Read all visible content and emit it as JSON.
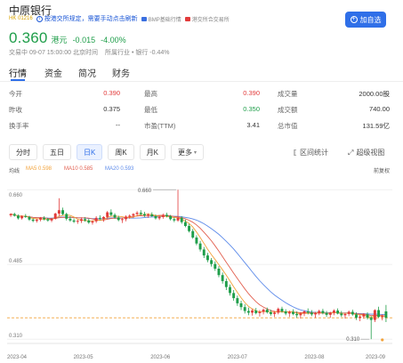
{
  "header": {
    "stock_name": "中原银行",
    "market_tag": "HK 01216",
    "notice": "按港交所规定，需要手动点击刷新",
    "notice_icon": "info-icon",
    "tag_bmp": "BMP基础行情",
    "tag_trade": "港交所合交易所",
    "watch_label": "加自选",
    "watch_icon": "plus-circle-icon"
  },
  "quote": {
    "price": "0.360",
    "currency": "港元",
    "change": "-0.015",
    "change_pct": "-4.00%",
    "status_time": "交易中 09-07 15:00:00 北京时间",
    "industry": "所属行业 • 银行 -0.44%",
    "down_color": "#1f9e4a",
    "up_color": "#e23b3b"
  },
  "tabs": [
    "行情",
    "资金",
    "简况",
    "财务"
  ],
  "stats": [
    [
      {
        "label": "今开",
        "value": "0.390",
        "color": "red"
      },
      {
        "label": "最高",
        "value": "0.390",
        "color": "red"
      },
      {
        "label": "成交量",
        "value": "2000.00股",
        "color": ""
      }
    ],
    [
      {
        "label": "昨收",
        "value": "0.375",
        "color": ""
      },
      {
        "label": "最低",
        "value": "0.350",
        "color": "green"
      },
      {
        "label": "成交额",
        "value": "740.00",
        "color": ""
      }
    ],
    [
      {
        "label": "换手率",
        "value": "--",
        "color": ""
      },
      {
        "label": "市盈(TTM)",
        "value": "3.41",
        "color": ""
      },
      {
        "label": "总市值",
        "value": "131.59亿",
        "color": ""
      }
    ]
  ],
  "periods": {
    "items": [
      "分时",
      "五日",
      "日K",
      "周K",
      "月K",
      "更多"
    ],
    "selected": "日K"
  },
  "tools": {
    "range_stats": "区间统计",
    "range_icon": "range-bracket-icon",
    "fullscreen": "超级视图",
    "fullscreen_icon": "expand-icon"
  },
  "legend": {
    "adjust": "均线",
    "ma5": "MA5 0.598",
    "ma10": "MA10 0.585",
    "ma20": "MA20 0.593",
    "right": "前复权",
    "ma5_color": "#f2a23a",
    "ma10_color": "#e25f4f",
    "ma20_color": "#5d8bea"
  },
  "chart_data": {
    "type": "candlestick",
    "y_ticks": [
      "0.660",
      "0.485",
      "0.310"
    ],
    "ylim": [
      0.3,
      0.675
    ],
    "x_ticks": [
      "2023-04",
      "2023-05",
      "2023-06",
      "2023-07",
      "2023-08",
      "2023-09"
    ],
    "annotations": [
      {
        "text": "0.660",
        "type": "max"
      },
      {
        "text": "0.310",
        "type": "min"
      }
    ],
    "last_price": 0.36,
    "candles": [
      [
        0.6,
        0.605,
        0.596,
        0.603
      ],
      [
        0.603,
        0.606,
        0.597,
        0.599
      ],
      [
        0.599,
        0.602,
        0.59,
        0.593
      ],
      [
        0.593,
        0.6,
        0.59,
        0.598
      ],
      [
        0.598,
        0.603,
        0.594,
        0.596
      ],
      [
        0.596,
        0.599,
        0.587,
        0.59
      ],
      [
        0.59,
        0.593,
        0.584,
        0.587
      ],
      [
        0.587,
        0.592,
        0.583,
        0.59
      ],
      [
        0.59,
        0.596,
        0.586,
        0.594
      ],
      [
        0.594,
        0.598,
        0.588,
        0.591
      ],
      [
        0.591,
        0.594,
        0.585,
        0.588
      ],
      [
        0.588,
        0.594,
        0.584,
        0.592
      ],
      [
        0.592,
        0.606,
        0.59,
        0.604
      ],
      [
        0.604,
        0.64,
        0.598,
        0.612
      ],
      [
        0.612,
        0.618,
        0.6,
        0.603
      ],
      [
        0.603,
        0.606,
        0.588,
        0.592
      ],
      [
        0.592,
        0.598,
        0.585,
        0.588
      ],
      [
        0.588,
        0.593,
        0.582,
        0.585
      ],
      [
        0.585,
        0.59,
        0.58,
        0.587
      ],
      [
        0.587,
        0.595,
        0.582,
        0.591
      ],
      [
        0.591,
        0.596,
        0.585,
        0.588
      ],
      [
        0.588,
        0.592,
        0.58,
        0.583
      ],
      [
        0.583,
        0.588,
        0.578,
        0.586
      ],
      [
        0.586,
        0.598,
        0.582,
        0.594
      ],
      [
        0.594,
        0.6,
        0.588,
        0.592
      ],
      [
        0.592,
        0.598,
        0.585,
        0.596
      ],
      [
        0.596,
        0.61,
        0.592,
        0.607
      ],
      [
        0.607,
        0.614,
        0.598,
        0.601
      ],
      [
        0.601,
        0.605,
        0.592,
        0.595
      ],
      [
        0.595,
        0.599,
        0.586,
        0.589
      ],
      [
        0.589,
        0.594,
        0.582,
        0.591
      ],
      [
        0.591,
        0.6,
        0.586,
        0.597
      ],
      [
        0.597,
        0.602,
        0.592,
        0.599
      ],
      [
        0.599,
        0.605,
        0.594,
        0.603
      ],
      [
        0.603,
        0.61,
        0.598,
        0.606
      ],
      [
        0.606,
        0.612,
        0.6,
        0.603
      ],
      [
        0.603,
        0.608,
        0.596,
        0.6
      ],
      [
        0.6,
        0.605,
        0.594,
        0.602
      ],
      [
        0.602,
        0.607,
        0.596,
        0.598
      ],
      [
        0.598,
        0.602,
        0.59,
        0.593
      ],
      [
        0.593,
        0.599,
        0.589,
        0.596
      ],
      [
        0.596,
        0.604,
        0.592,
        0.601
      ],
      [
        0.601,
        0.606,
        0.595,
        0.598
      ],
      [
        0.598,
        0.601,
        0.588,
        0.591
      ],
      [
        0.591,
        0.595,
        0.584,
        0.588
      ],
      [
        0.588,
        0.66,
        0.585,
        0.594
      ],
      [
        0.594,
        0.598,
        0.58,
        0.584
      ],
      [
        0.584,
        0.59,
        0.572,
        0.575
      ],
      [
        0.575,
        0.58,
        0.56,
        0.563
      ],
      [
        0.563,
        0.568,
        0.545,
        0.548
      ],
      [
        0.548,
        0.553,
        0.53,
        0.534
      ],
      [
        0.534,
        0.54,
        0.515,
        0.52
      ],
      [
        0.52,
        0.526,
        0.5,
        0.506
      ],
      [
        0.506,
        0.512,
        0.49,
        0.495
      ],
      [
        0.495,
        0.5,
        0.48,
        0.486
      ],
      [
        0.486,
        0.492,
        0.47,
        0.475
      ],
      [
        0.475,
        0.481,
        0.455,
        0.46
      ],
      [
        0.46,
        0.466,
        0.44,
        0.446
      ],
      [
        0.446,
        0.452,
        0.425,
        0.432
      ],
      [
        0.432,
        0.438,
        0.412,
        0.418
      ],
      [
        0.418,
        0.425,
        0.4,
        0.406
      ],
      [
        0.406,
        0.412,
        0.388,
        0.394
      ],
      [
        0.394,
        0.4,
        0.378,
        0.385
      ],
      [
        0.385,
        0.392,
        0.37,
        0.376
      ],
      [
        0.376,
        0.384,
        0.366,
        0.372
      ],
      [
        0.372,
        0.381,
        0.365,
        0.377
      ],
      [
        0.377,
        0.383,
        0.368,
        0.371
      ],
      [
        0.371,
        0.378,
        0.363,
        0.374
      ],
      [
        0.374,
        0.382,
        0.368,
        0.379
      ],
      [
        0.379,
        0.384,
        0.37,
        0.373
      ],
      [
        0.373,
        0.379,
        0.365,
        0.369
      ],
      [
        0.369,
        0.376,
        0.362,
        0.372
      ],
      [
        0.372,
        0.384,
        0.368,
        0.381
      ],
      [
        0.381,
        0.386,
        0.372,
        0.375
      ],
      [
        0.375,
        0.38,
        0.366,
        0.37
      ],
      [
        0.37,
        0.377,
        0.362,
        0.374
      ],
      [
        0.374,
        0.38,
        0.366,
        0.369
      ],
      [
        0.369,
        0.375,
        0.36,
        0.366
      ],
      [
        0.366,
        0.373,
        0.358,
        0.37
      ],
      [
        0.37,
        0.378,
        0.364,
        0.375
      ],
      [
        0.375,
        0.382,
        0.368,
        0.372
      ],
      [
        0.372,
        0.378,
        0.364,
        0.368
      ],
      [
        0.368,
        0.374,
        0.36,
        0.371
      ],
      [
        0.371,
        0.379,
        0.366,
        0.376
      ],
      [
        0.376,
        0.381,
        0.368,
        0.371
      ],
      [
        0.371,
        0.376,
        0.362,
        0.367
      ],
      [
        0.367,
        0.374,
        0.36,
        0.372
      ],
      [
        0.372,
        0.38,
        0.366,
        0.377
      ],
      [
        0.377,
        0.382,
        0.368,
        0.37
      ],
      [
        0.37,
        0.376,
        0.362,
        0.366
      ],
      [
        0.366,
        0.372,
        0.358,
        0.369
      ],
      [
        0.369,
        0.377,
        0.364,
        0.374
      ],
      [
        0.374,
        0.379,
        0.365,
        0.368
      ],
      [
        0.368,
        0.373,
        0.355,
        0.36
      ],
      [
        0.36,
        0.366,
        0.352,
        0.363
      ],
      [
        0.363,
        0.371,
        0.358,
        0.368
      ],
      [
        0.368,
        0.373,
        0.356,
        0.36
      ],
      [
        0.36,
        0.364,
        0.31,
        0.355
      ],
      [
        0.355,
        0.38,
        0.35,
        0.378
      ],
      [
        0.378,
        0.386,
        0.36,
        0.362
      ],
      [
        0.362,
        0.368,
        0.354,
        0.365
      ],
      [
        0.375,
        0.39,
        0.35,
        0.36
      ]
    ]
  }
}
